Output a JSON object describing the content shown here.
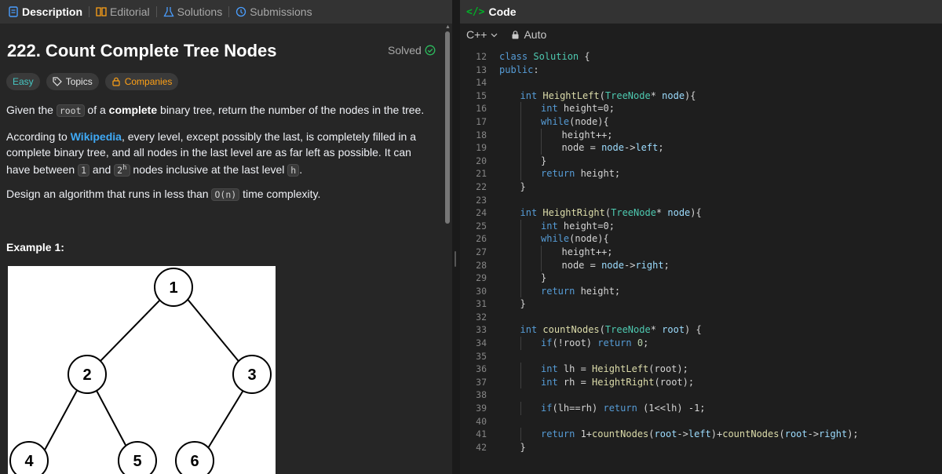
{
  "left_tabs": [
    {
      "label": "Description",
      "icon": "description-icon",
      "active": true
    },
    {
      "label": "Editorial",
      "icon": "book-icon",
      "active": false
    },
    {
      "label": "Solutions",
      "icon": "flask-icon",
      "active": false
    },
    {
      "label": "Submissions",
      "icon": "history-icon",
      "active": false
    }
  ],
  "problem": {
    "title": "222. Count Complete Tree Nodes",
    "status": "Solved",
    "tags": {
      "difficulty": "Easy",
      "topics": "Topics",
      "companies": "Companies"
    },
    "p1": {
      "pre": "Given the ",
      "code": "root",
      "mid": " of a ",
      "bold": "complete",
      "post": " binary tree, return the number of the nodes in the tree."
    },
    "p2": {
      "pre": "According to ",
      "link": "Wikipedia",
      "mid": ", every level, except possibly the last, is completely filled in a complete binary tree, and all nodes in the last level are as far left as possible. It can have between ",
      "code1": "1",
      "and": " and ",
      "base": "2",
      "sup": "h",
      "post": " nodes inclusive at the last level ",
      "code2": "h",
      "end": "."
    },
    "p3": {
      "pre": "Design an algorithm that runs in less than ",
      "code": "O(n)",
      "post": " time complexity."
    },
    "example_title": "Example 1:",
    "tree_nodes": [
      "1",
      "2",
      "3",
      "4",
      "5",
      "6"
    ]
  },
  "code_panel": {
    "title": "Code",
    "language": "C++",
    "mode": "Auto",
    "lines": [
      {
        "n": "12",
        "indent": 0,
        "tokens": [
          [
            "kw",
            "class "
          ],
          [
            "ty",
            "Solution"
          ],
          [
            "op",
            " {"
          ]
        ]
      },
      {
        "n": "13",
        "indent": 0,
        "tokens": [
          [
            "kw",
            "public"
          ],
          [
            "op",
            ":"
          ]
        ]
      },
      {
        "n": "14",
        "indent": 0,
        "tokens": []
      },
      {
        "n": "15",
        "indent": 1,
        "tokens": [
          [
            "kw",
            "int "
          ],
          [
            "fn",
            "HeightLeft"
          ],
          [
            "op",
            "("
          ],
          [
            "ty",
            "TreeNode"
          ],
          [
            "op",
            "* "
          ],
          [
            "var",
            "node"
          ],
          [
            "op",
            "){"
          ]
        ]
      },
      {
        "n": "16",
        "indent": 2,
        "tokens": [
          [
            "kw",
            "int "
          ],
          [
            "op",
            "height=0;"
          ]
        ]
      },
      {
        "n": "17",
        "indent": 2,
        "tokens": [
          [
            "kw",
            "while"
          ],
          [
            "op",
            "(node){"
          ]
        ]
      },
      {
        "n": "18",
        "indent": 3,
        "tokens": [
          [
            "op",
            "height++;"
          ]
        ]
      },
      {
        "n": "19",
        "indent": 3,
        "tokens": [
          [
            "op",
            "node = "
          ],
          [
            "var",
            "node"
          ],
          [
            "op",
            "->"
          ],
          [
            "var",
            "left"
          ],
          [
            "op",
            ";"
          ]
        ]
      },
      {
        "n": "20",
        "indent": 2,
        "tokens": [
          [
            "op",
            "}"
          ]
        ]
      },
      {
        "n": "21",
        "indent": 2,
        "tokens": [
          [
            "kw",
            "return "
          ],
          [
            "op",
            "height;"
          ]
        ]
      },
      {
        "n": "22",
        "indent": 1,
        "tokens": [
          [
            "op",
            "}"
          ]
        ]
      },
      {
        "n": "23",
        "indent": 0,
        "tokens": []
      },
      {
        "n": "24",
        "indent": 1,
        "tokens": [
          [
            "kw",
            "int "
          ],
          [
            "fn",
            "HeightRight"
          ],
          [
            "op",
            "("
          ],
          [
            "ty",
            "TreeNode"
          ],
          [
            "op",
            "* "
          ],
          [
            "var",
            "node"
          ],
          [
            "op",
            "){"
          ]
        ]
      },
      {
        "n": "25",
        "indent": 2,
        "tokens": [
          [
            "kw",
            "int "
          ],
          [
            "op",
            "height=0;"
          ]
        ]
      },
      {
        "n": "26",
        "indent": 2,
        "tokens": [
          [
            "kw",
            "while"
          ],
          [
            "op",
            "(node){"
          ]
        ]
      },
      {
        "n": "27",
        "indent": 3,
        "tokens": [
          [
            "op",
            "height++;"
          ]
        ]
      },
      {
        "n": "28",
        "indent": 3,
        "tokens": [
          [
            "op",
            "node = "
          ],
          [
            "var",
            "node"
          ],
          [
            "op",
            "->"
          ],
          [
            "var",
            "right"
          ],
          [
            "op",
            ";"
          ]
        ]
      },
      {
        "n": "29",
        "indent": 2,
        "tokens": [
          [
            "op",
            "}"
          ]
        ]
      },
      {
        "n": "30",
        "indent": 2,
        "tokens": [
          [
            "kw",
            "return "
          ],
          [
            "op",
            "height;"
          ]
        ]
      },
      {
        "n": "31",
        "indent": 1,
        "tokens": [
          [
            "op",
            "}"
          ]
        ]
      },
      {
        "n": "32",
        "indent": 0,
        "tokens": []
      },
      {
        "n": "33",
        "indent": 1,
        "tokens": [
          [
            "kw",
            "int "
          ],
          [
            "fn",
            "countNodes"
          ],
          [
            "op",
            "("
          ],
          [
            "ty",
            "TreeNode"
          ],
          [
            "op",
            "* "
          ],
          [
            "var",
            "root"
          ],
          [
            "op",
            ") {"
          ]
        ]
      },
      {
        "n": "34",
        "indent": 2,
        "tokens": [
          [
            "kw",
            "if"
          ],
          [
            "op",
            "(!root) "
          ],
          [
            "kw",
            "return "
          ],
          [
            "num",
            "0"
          ],
          [
            "op",
            ";"
          ]
        ]
      },
      {
        "n": "35",
        "indent": 0,
        "tokens": []
      },
      {
        "n": "36",
        "indent": 2,
        "tokens": [
          [
            "kw",
            "int "
          ],
          [
            "op",
            "lh = "
          ],
          [
            "fn",
            "HeightLeft"
          ],
          [
            "op",
            "(root);"
          ]
        ]
      },
      {
        "n": "37",
        "indent": 2,
        "tokens": [
          [
            "kw",
            "int "
          ],
          [
            "op",
            "rh = "
          ],
          [
            "fn",
            "HeightRight"
          ],
          [
            "op",
            "(root);"
          ]
        ]
      },
      {
        "n": "38",
        "indent": 0,
        "tokens": []
      },
      {
        "n": "39",
        "indent": 2,
        "tokens": [
          [
            "kw",
            "if"
          ],
          [
            "op",
            "(lh==rh) "
          ],
          [
            "kw",
            "return "
          ],
          [
            "op",
            "(1<<lh) -1;"
          ]
        ]
      },
      {
        "n": "40",
        "indent": 0,
        "tokens": []
      },
      {
        "n": "41",
        "indent": 2,
        "tokens": [
          [
            "kw",
            "return "
          ],
          [
            "op",
            "1+"
          ],
          [
            "fn",
            "countNodes"
          ],
          [
            "op",
            "("
          ],
          [
            "var",
            "root"
          ],
          [
            "op",
            "->"
          ],
          [
            "var",
            "left"
          ],
          [
            "op",
            ")+"
          ],
          [
            "fn",
            "countNodes"
          ],
          [
            "op",
            "("
          ],
          [
            "var",
            "root"
          ],
          [
            "op",
            "->"
          ],
          [
            "var",
            "right"
          ],
          [
            "op",
            ");"
          ]
        ]
      },
      {
        "n": "42",
        "indent": 1,
        "tokens": [
          [
            "op",
            "}"
          ]
        ]
      }
    ]
  },
  "colors": {
    "easy": "#46c6c2",
    "companies": "#ffa116",
    "solved": "#2cbb5d",
    "link": "#3fa9f5",
    "code_icon": "#02b128"
  }
}
